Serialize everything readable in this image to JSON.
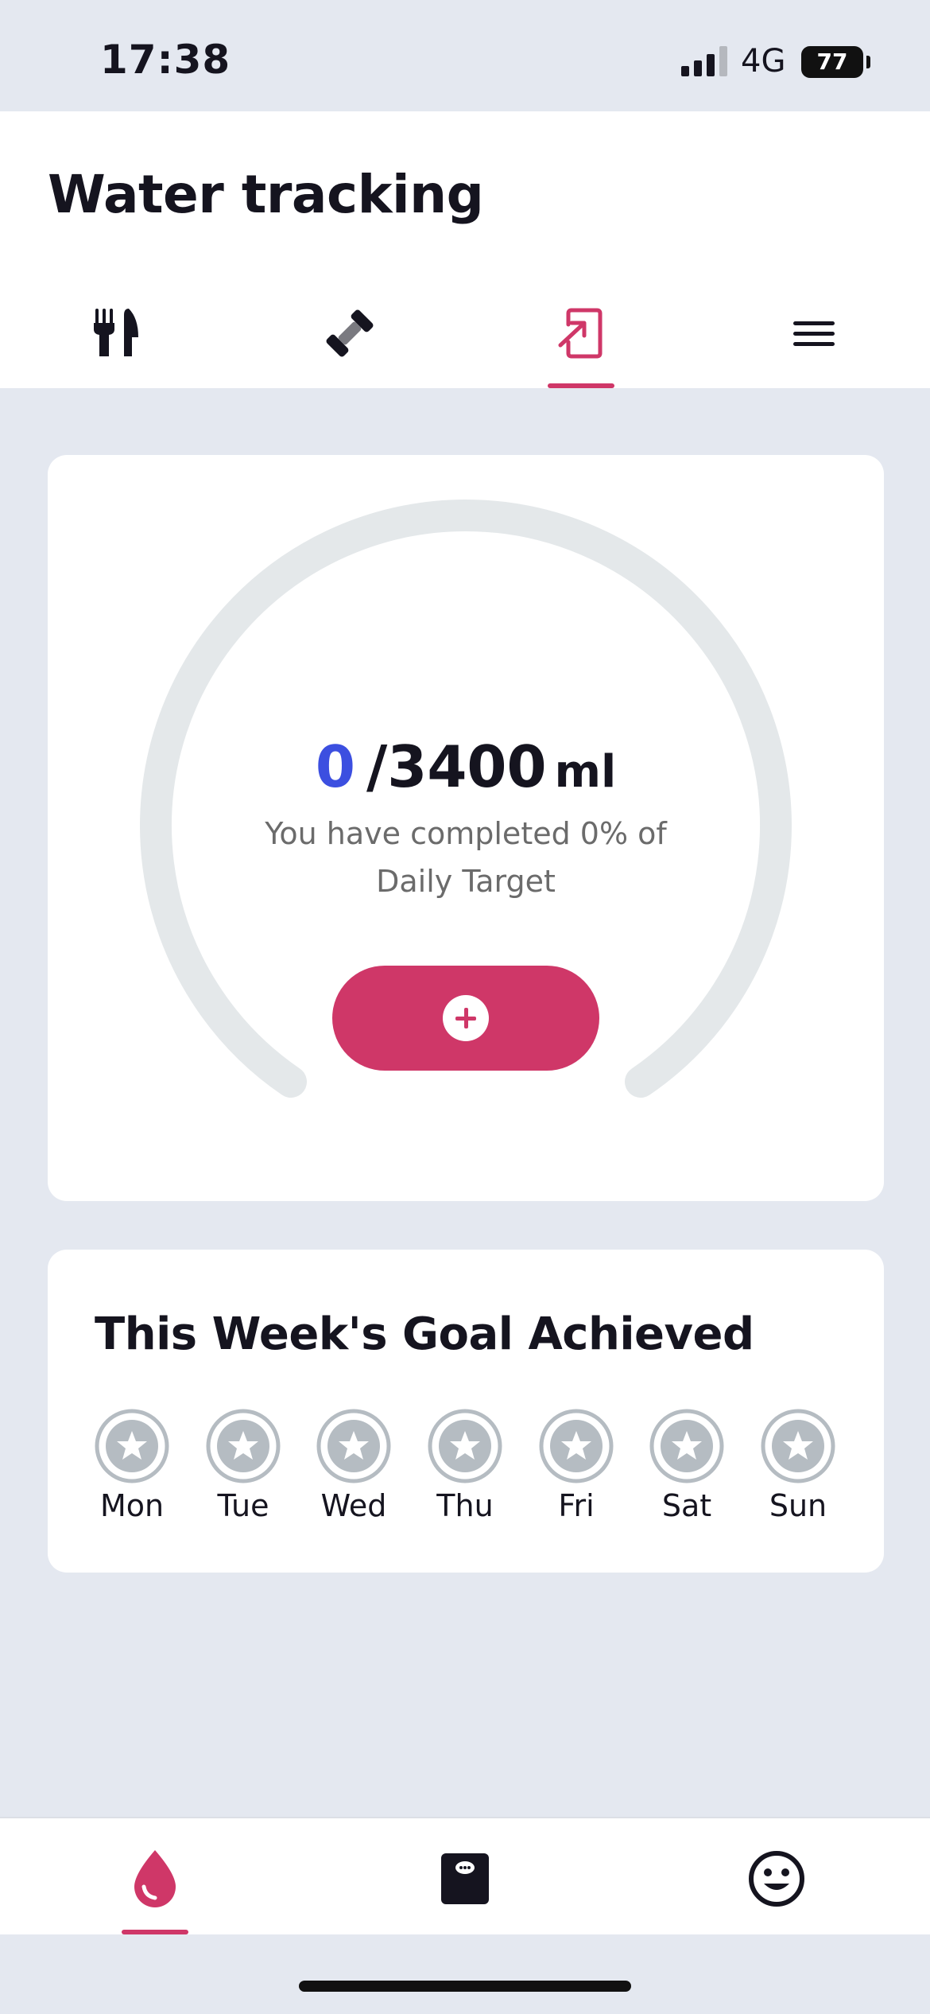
{
  "status_bar": {
    "time": "17:38",
    "network": "4G",
    "battery": "77",
    "icons": [
      "signal-icon",
      "battery-icon"
    ]
  },
  "header": {
    "title": "Water tracking",
    "tabs": [
      {
        "icon": "fork-knife-icon",
        "active": false
      },
      {
        "icon": "dumbbell-icon",
        "active": false
      },
      {
        "icon": "water-log-icon",
        "active": true
      },
      {
        "icon": "menu-icon",
        "active": false
      }
    ]
  },
  "water": {
    "current": "0",
    "target": "/3400",
    "unit": "ml",
    "completion_text": "You have completed 0% of Daily Target",
    "progress_fraction": 0,
    "add_button_icon": "plus-icon"
  },
  "weekly_goal": {
    "title": "This Week's Goal Achieved",
    "days": [
      "Mon",
      "Tue",
      "Wed",
      "Thu",
      "Fri",
      "Sat",
      "Sun"
    ],
    "achieved": [
      false,
      false,
      false,
      false,
      false,
      false,
      false
    ]
  },
  "bottom_nav": {
    "items": [
      {
        "icon": "water-drop-icon",
        "active": true
      },
      {
        "icon": "chat-icon",
        "active": false
      },
      {
        "icon": "smiley-icon",
        "active": false
      }
    ]
  },
  "colors": {
    "accent": "#cf3768",
    "current_value": "#3c4fe0",
    "gauge_track": "#e4e8ea",
    "star_badge": "#b5bcc2",
    "background": "#e4e8f0"
  }
}
